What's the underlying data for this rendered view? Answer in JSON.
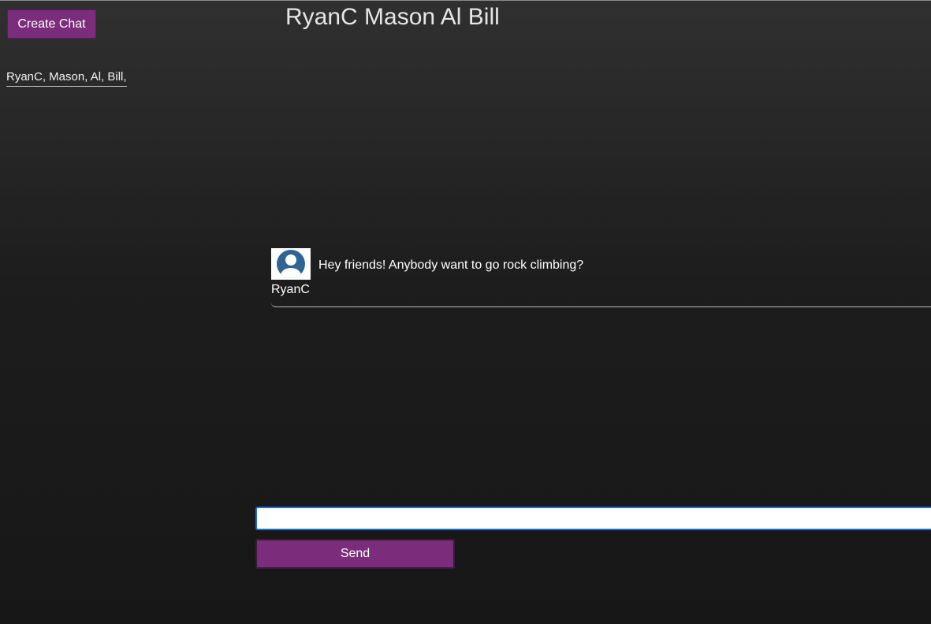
{
  "sidebar": {
    "create_chat_label": "Create Chat",
    "chats": [
      {
        "label": "RyanC, Mason, Al, Bill,"
      }
    ]
  },
  "chat": {
    "title": "RyanC Mason Al Bill",
    "messages": [
      {
        "author": "RyanC",
        "text": "Hey friends! Anybody want to go rock climbing?",
        "avatar_icon": "user-avatar-icon"
      }
    ]
  },
  "composer": {
    "input_value": "",
    "send_label": "Send"
  },
  "colors": {
    "accent": "#7b2d7b",
    "avatar": "#2f6495",
    "focus_ring": "#1f6fd1"
  }
}
